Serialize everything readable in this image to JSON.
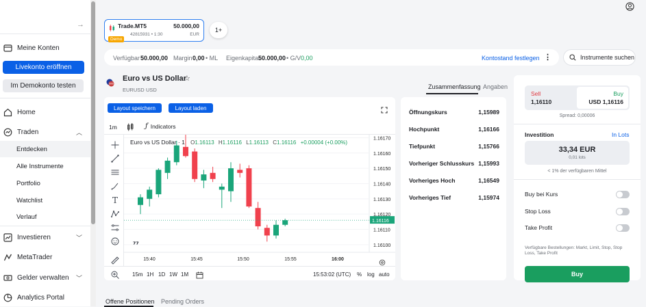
{
  "sidebar": {
    "accounts_label": "Meine Konten",
    "open_live_label": "Livekonto eröffnen",
    "try_demo_label": "Im Demokonto testen",
    "home_label": "Home",
    "trade_label": "Traden",
    "trade_sub": [
      "Entdecken",
      "Alle Instrumente",
      "Portfolio",
      "Watchlist",
      "Verlauf"
    ],
    "invest_label": "Investieren",
    "metatrader_label": "MetaTrader",
    "funds_label": "Gelder verwalten",
    "analytics_label": "Analytics Portal"
  },
  "account": {
    "name": "Trade.MT5",
    "balance": "50.000,00",
    "badge": "Demo",
    "meta": "42815931 • 1:30",
    "currency": "EUR",
    "add_label": "1+"
  },
  "info_bar": {
    "available_label": "Verfügbar",
    "available_value": "50.000,00",
    "margin_label": "Margin",
    "margin_value": "0,00",
    "margin_suffix": "• ML",
    "equity_label": "Eigenkapital",
    "equity_value": "50.000,00",
    "pl_label": "• G/V",
    "pl_value": "0,00",
    "set_balance_link": "Kontostand festlegen",
    "more_icon": "vertical-ellipsis",
    "search_label": "Instrumente suchen"
  },
  "instrument": {
    "title": "Euro vs US Dollar",
    "code": "EURUSD",
    "currency": "USD",
    "tab_summary": "Zusammenfassung",
    "tab_details": "Angaben"
  },
  "chart_toolbar": {
    "save_layout": "Layout speichern",
    "load_layout": "Layout laden",
    "interval": "1m",
    "indicators": "Indicators"
  },
  "chart_header": {
    "symbol": "Euro vs US Dollar · 1",
    "o_label": "O",
    "o_value": "1.16113",
    "h_label": "H",
    "h_value": "1.16116",
    "l_label": "L",
    "l_value": "1.16113",
    "c_label": "C",
    "c_value": "1.16116",
    "change": "+0.00004 (+0.00%)"
  },
  "chart_bottom": {
    "ranges": [
      "15m",
      "1H",
      "1D",
      "1W",
      "1M"
    ],
    "time": "15:53:02 (UTC)",
    "percent": "%",
    "log": "log",
    "auto": "auto"
  },
  "chart_data": {
    "type": "candlestick",
    "x_ticks": [
      "15:40",
      "15:45",
      "15:50",
      "15:55",
      "16:00"
    ],
    "y_ticks": [
      "1.16170",
      "1.16160",
      "1.16150",
      "1.16140",
      "1.16130",
      "1.16120",
      "1.16110",
      "1.16100"
    ],
    "ylim": [
      1.16095,
      1.16172
    ],
    "current_price": "1.16116",
    "candles": [
      {
        "o": 1.16126,
        "h": 1.16133,
        "l": 1.1612,
        "c": 1.16131
      },
      {
        "o": 1.1613,
        "h": 1.16138,
        "l": 1.16125,
        "c": 1.16136
      },
      {
        "o": 1.16133,
        "h": 1.1615,
        "l": 1.16131,
        "c": 1.16149
      },
      {
        "o": 1.16147,
        "h": 1.16157,
        "l": 1.16143,
        "c": 1.16155
      },
      {
        "o": 1.16154,
        "h": 1.16168,
        "l": 1.16152,
        "c": 1.16165
      },
      {
        "o": 1.16164,
        "h": 1.16172,
        "l": 1.16157,
        "c": 1.16158
      },
      {
        "o": 1.16161,
        "h": 1.16163,
        "l": 1.16141,
        "c": 1.16143
      },
      {
        "o": 1.16142,
        "h": 1.16149,
        "l": 1.16137,
        "c": 1.16146
      },
      {
        "o": 1.16147,
        "h": 1.16151,
        "l": 1.16141,
        "c": 1.16143
      },
      {
        "o": 1.16136,
        "h": 1.1614,
        "l": 1.16124,
        "c": 1.16138
      },
      {
        "o": 1.16135,
        "h": 1.16154,
        "l": 1.16128,
        "c": 1.1615
      },
      {
        "o": 1.16149,
        "h": 1.16153,
        "l": 1.16144,
        "c": 1.16147
      },
      {
        "o": 1.1615,
        "h": 1.16152,
        "l": 1.16124,
        "c": 1.16125
      },
      {
        "o": 1.16124,
        "h": 1.16128,
        "l": 1.1611,
        "c": 1.16112
      },
      {
        "o": 1.16111,
        "h": 1.16113,
        "l": 1.16102,
        "c": 1.16106
      },
      {
        "o": 1.16106,
        "h": 1.16116,
        "l": 1.16104,
        "c": 1.16113
      },
      {
        "o": 1.16113,
        "h": 1.16117,
        "l": 1.16112,
        "c": 1.16116
      }
    ]
  },
  "stats": [
    {
      "label": "Öffnungskurs",
      "value": "1,15989"
    },
    {
      "label": "Hochpunkt",
      "value": "1,16166"
    },
    {
      "label": "Tiefpunkt",
      "value": "1,15766"
    },
    {
      "label": "Vorheriger Schlusskurs",
      "value": "1,15993"
    },
    {
      "label": "Vorheriges Hoch",
      "value": "1,16549"
    },
    {
      "label": "Vorheriges Tief",
      "value": "1,15974"
    }
  ],
  "order": {
    "sell_label": "Sell",
    "sell_price": "1,16110",
    "buy_label": "Buy",
    "buy_price": "USD 1,16116",
    "spread": "Spread: 0,00006",
    "investment_label": "Investition",
    "unit_toggle": "In Lots",
    "amount": "33,34 EUR",
    "lots": "0,01 lots",
    "margin_note": "< 1% der verfügbaren Mittel",
    "buy_at_price": "Buy bei Kurs",
    "stop_loss": "Stop Loss",
    "take_profit": "Take Profit",
    "order_types_note": "Verfügbare Bestellungen: Markt, Limit, Stop, Stop Loss, Take Profit",
    "submit": "Buy"
  },
  "bottom_tabs": {
    "open_positions": "Offene Positionen",
    "pending_orders": "Pending Orders"
  },
  "colors": {
    "accent": "#0a60e6",
    "bull": "#1aa57a",
    "bear": "#f0414d",
    "buy_button": "#1a9e5f"
  }
}
